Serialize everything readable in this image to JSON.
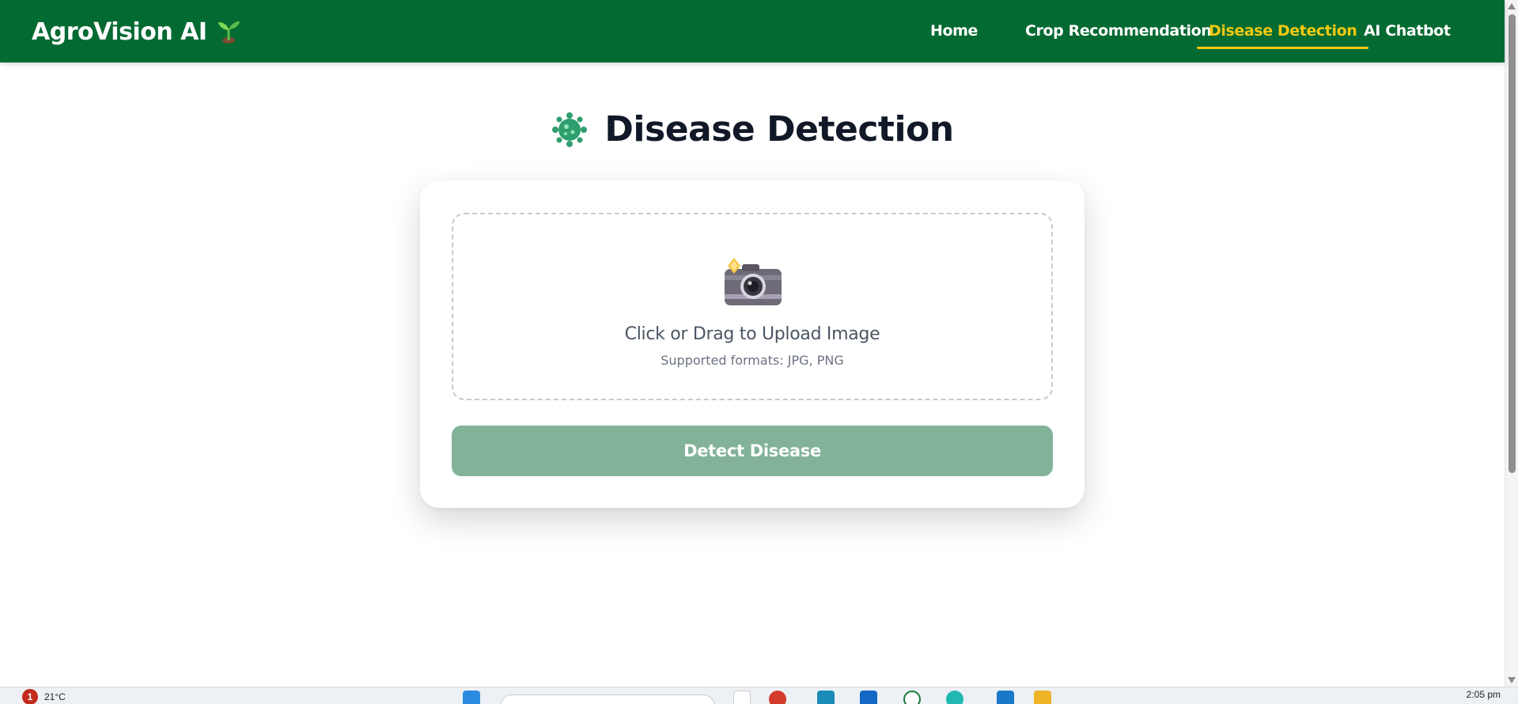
{
  "navbar": {
    "brand": "AgroVision AI",
    "brand_icon": "seedling-icon",
    "links": [
      {
        "label": "Home",
        "active": false
      },
      {
        "label": "Crop Recommendation",
        "active": false
      },
      {
        "label": "Disease Detection",
        "active": true
      },
      {
        "label": "AI Chatbot",
        "active": false
      }
    ],
    "background_color": "#036a31",
    "active_color": "#f2c811"
  },
  "main": {
    "title_icon": "microbe-icon",
    "title": "Disease Detection",
    "upload": {
      "icon": "camera-with-flash-icon",
      "title": "Click or Drag to Upload Image",
      "subtitle": "Supported formats: JPG, PNG"
    },
    "detect_button_label": "Detect Disease",
    "button_color": "#82b399"
  },
  "taskbar": {
    "notification_count": "1",
    "temperature": "21°C",
    "time": "2:05 pm"
  }
}
